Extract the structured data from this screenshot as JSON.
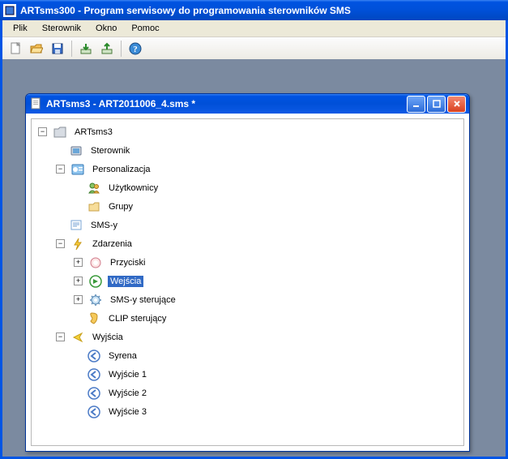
{
  "app": {
    "title": "ARTsms300 - Program serwisowy do programowania sterowników SMS"
  },
  "menu": {
    "plik": "Plik",
    "sterownik": "Sterownik",
    "okno": "Okno",
    "pomoc": "Pomoc"
  },
  "toolbar": {
    "new": "new-file",
    "open": "open-file",
    "save": "save-file",
    "download": "download",
    "upload": "upload",
    "help": "help"
  },
  "doc": {
    "title": "ARTsms3 - ART2011006_4.sms *"
  },
  "tree": {
    "root": "ARTsms3",
    "sterownik": "Sterownik",
    "personalizacja": "Personalizacja",
    "uzytkownicy": "Użytkownicy",
    "grupy": "Grupy",
    "smsy": "SMS-y",
    "zdarzenia": "Zdarzenia",
    "przyciski": "Przyciski",
    "wejscia": "Wejścia",
    "smsy_sterujace": "SMS-y sterujące",
    "clip_sterujacy": "CLIP sterujący",
    "wyjscia": "Wyjścia",
    "syrena": "Syrena",
    "wyjscie1": "Wyjście 1",
    "wyjscie2": "Wyjście 2",
    "wyjscie3": "Wyjście 3"
  }
}
